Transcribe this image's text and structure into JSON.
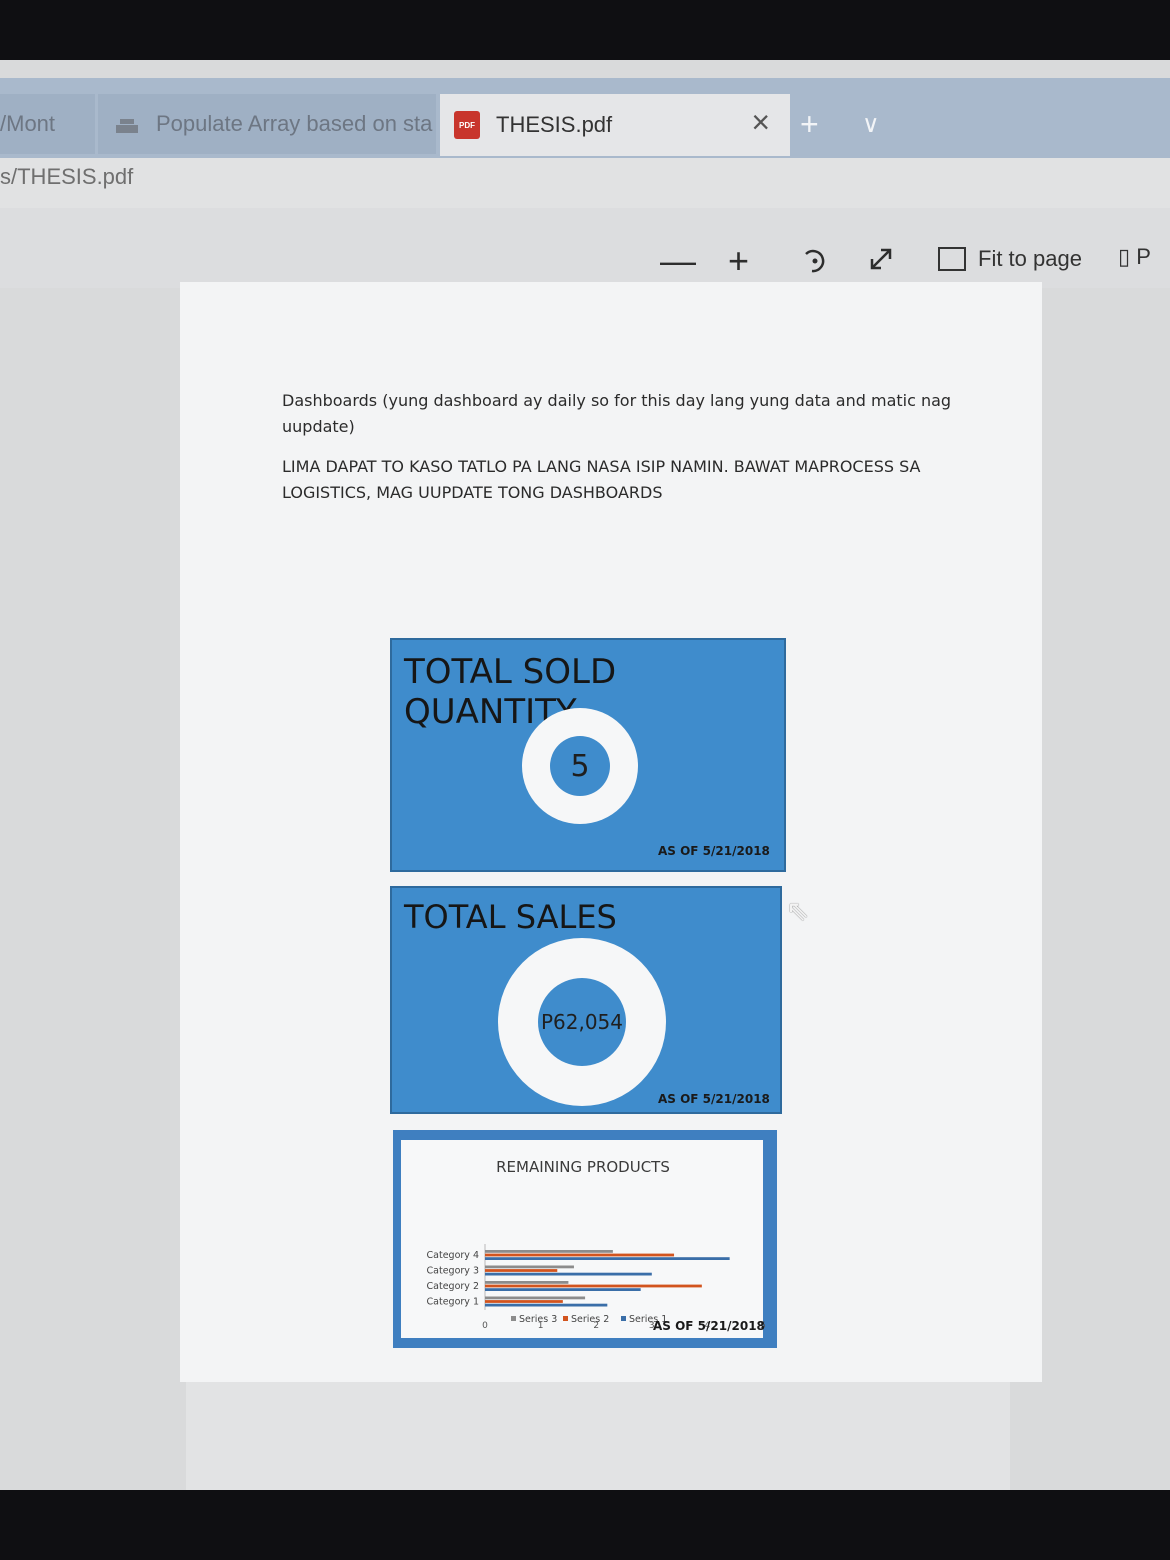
{
  "tabs": [
    {
      "label": "/Mont"
    },
    {
      "label": "Populate Array based on sta"
    },
    {
      "label": "THESIS.pdf",
      "close": "×"
    }
  ],
  "tab_actions": {
    "new_tab": "+",
    "dropdown": "∨"
  },
  "address": {
    "text": "s/THESIS.pdf"
  },
  "toolbar": {
    "zoom_out": "—",
    "zoom_in": "+",
    "rotate_icon": "rotate-icon",
    "fullscreen_icon": "expand-icon",
    "fit_label": "Fit to page",
    "page_view": "P"
  },
  "document": {
    "para1": "Dashboards (yung dashboard ay daily so for this day lang yung data and matic nag uupdate)",
    "para2": "LIMA DAPAT TO KASO TATLO PA LANG NASA ISIP NAMIN. BAWAT MAPROCESS SA LOGISTICS, MAG UUPDATE TONG DASHBOARDS"
  },
  "cards": {
    "sold": {
      "title": "TOTAL SOLD QUANTITY",
      "value": "5",
      "asof": "AS OF 5/21/2018"
    },
    "sales": {
      "title": "TOTAL SALES",
      "value": "P62,054",
      "asof": "AS OF 5/21/2018"
    }
  },
  "chart_data": {
    "type": "bar",
    "orientation": "horizontal",
    "title": "REMAINING PRODUCTS",
    "categories": [
      "Category 1",
      "Category 2",
      "Category 3",
      "Category 4"
    ],
    "series": [
      {
        "name": "Series 1",
        "values": [
          2.2,
          2.8,
          3.0,
          4.4
        ],
        "color": "#3a6ea8"
      },
      {
        "name": "Series 2",
        "values": [
          1.4,
          3.9,
          1.3,
          3.4
        ],
        "color": "#d2541e"
      },
      {
        "name": "Series 3",
        "values": [
          1.8,
          1.5,
          1.6,
          2.3
        ],
        "color": "#8c8c8c"
      }
    ],
    "xlim": [
      0,
      5
    ],
    "xticks": [
      "0",
      "1",
      "2",
      "3",
      "4",
      "5"
    ],
    "asof": "AS OF 5/21/2018"
  }
}
